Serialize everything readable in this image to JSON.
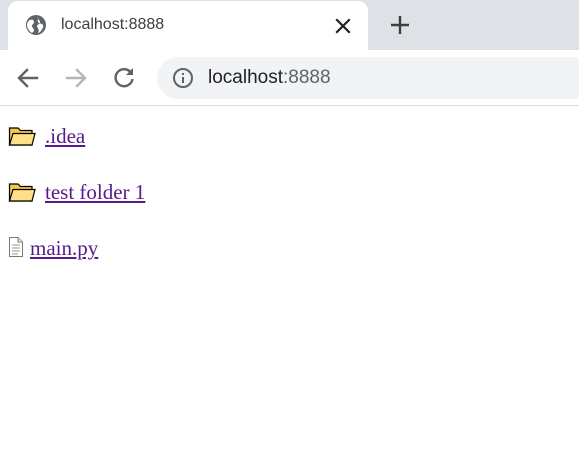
{
  "browser": {
    "tab": {
      "title": "localhost:8888",
      "favicon": "globe-icon",
      "close_icon": "close-icon"
    },
    "new_tab_icon": "plus-icon",
    "nav": {
      "back_icon": "back-arrow-icon",
      "forward_icon": "forward-arrow-icon",
      "reload_icon": "reload-icon"
    },
    "omnibox": {
      "security_icon": "info-icon",
      "host": "localhost",
      "port": ":8888"
    }
  },
  "listing": {
    "entries": [
      {
        "name": ".idea",
        "type": "folder",
        "icon": "folder-icon"
      },
      {
        "name": "test folder 1",
        "type": "folder",
        "icon": "folder-icon"
      },
      {
        "name": "main.py",
        "type": "file",
        "icon": "file-icon"
      }
    ]
  },
  "colors": {
    "tabstrip_bg": "#dee1e6",
    "omnibox_bg": "#f1f3f4",
    "visited_link": "#551a8b",
    "folder_fill": "#ffe08a"
  }
}
